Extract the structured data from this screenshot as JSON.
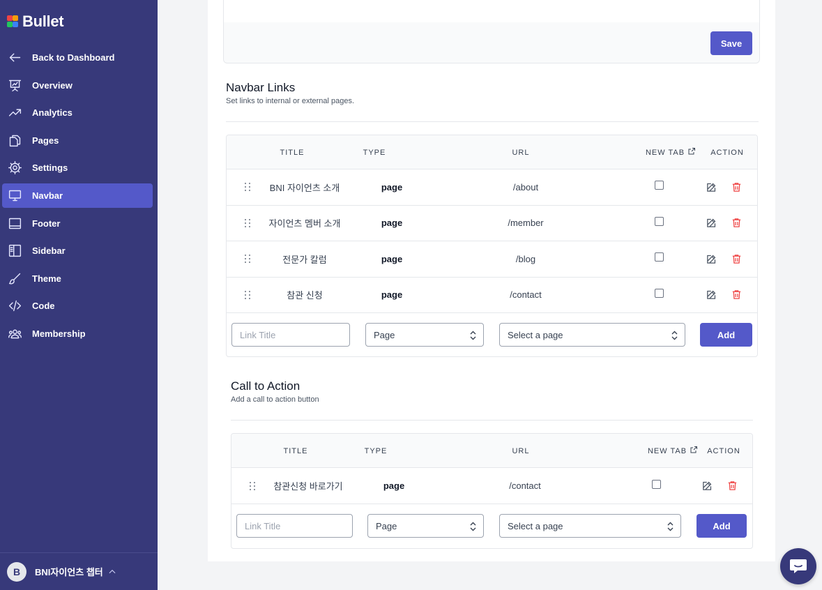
{
  "app": {
    "name": "Bullet"
  },
  "sidebar": {
    "items": [
      {
        "label": "Back to Dashboard",
        "icon": "arrow-left-icon"
      },
      {
        "label": "Overview",
        "icon": "presentation-chart-icon"
      },
      {
        "label": "Analytics",
        "icon": "trending-up-icon"
      },
      {
        "label": "Pages",
        "icon": "documents-icon"
      },
      {
        "label": "Settings",
        "icon": "gear-icon"
      },
      {
        "label": "Navbar",
        "icon": "desktop-icon",
        "active": true
      },
      {
        "label": "Footer",
        "icon": "footer-layout-icon"
      },
      {
        "label": "Sidebar",
        "icon": "sidebar-layout-icon"
      },
      {
        "label": "Theme",
        "icon": "brush-icon"
      },
      {
        "label": "Code",
        "icon": "code-icon"
      },
      {
        "label": "Membership",
        "icon": "users-icon"
      }
    ],
    "user": {
      "initial": "B",
      "name": "BNI자이언츠 챕터"
    }
  },
  "top_card": {
    "save_label": "Save"
  },
  "navbar_links": {
    "title": "Navbar Links",
    "subtitle": "Set links to internal or external pages.",
    "columns": {
      "title": "TITLE",
      "type": "TYPE",
      "url": "URL",
      "new_tab": "NEW TAB",
      "action": "ACTION"
    },
    "rows": [
      {
        "title": "BNI 자이언츠 소개",
        "type": "page",
        "url": "/about",
        "new_tab": false
      },
      {
        "title": "자이언츠 멤버 소개",
        "type": "page",
        "url": "/member",
        "new_tab": false
      },
      {
        "title": "전문가 칼럼",
        "type": "page",
        "url": "/blog",
        "new_tab": false
      },
      {
        "title": "참관 신청",
        "type": "page",
        "url": "/contact",
        "new_tab": false
      }
    ],
    "form": {
      "title_placeholder": "Link Title",
      "type_value": "Page",
      "page_value": "Select a page",
      "add_label": "Add"
    }
  },
  "call_to_action": {
    "title": "Call to Action",
    "subtitle": "Add a call to action button",
    "columns": {
      "title": "TITLE",
      "type": "TYPE",
      "url": "URL",
      "new_tab": "NEW TAB",
      "action": "ACTION"
    },
    "rows": [
      {
        "title": "참관신청 바로가기",
        "type": "page",
        "url": "/contact",
        "new_tab": false
      }
    ],
    "form": {
      "title_placeholder": "Link Title",
      "type_value": "Page",
      "page_value": "Select a page",
      "add_label": "Add"
    }
  },
  "colors": {
    "sidebar_bg": "#37397a",
    "accent": "#5459c9",
    "delete": "#ef4444"
  }
}
